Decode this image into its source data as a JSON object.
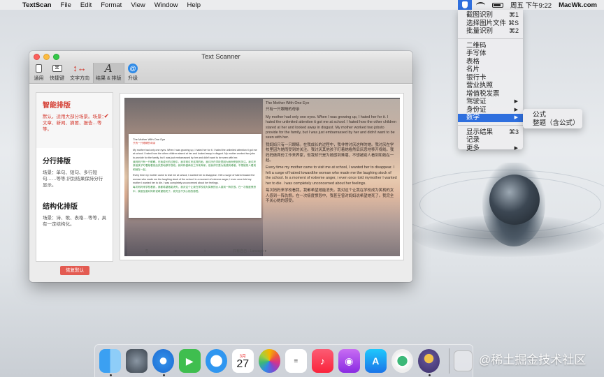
{
  "menubar": {
    "app_name": "TextScan",
    "menus": [
      "File",
      "Edit",
      "Format",
      "View",
      "Window",
      "Help"
    ],
    "clock": "周五 下午9:22",
    "site": "MacWk.com"
  },
  "status_menu": {
    "items": [
      {
        "label": "截图识别",
        "shortcut": "⌘1"
      },
      {
        "label": "选择图片文件",
        "shortcut": "⌘S"
      },
      {
        "label": "批量识别",
        "shortcut": "⌘2"
      }
    ],
    "types": [
      {
        "label": "二维码"
      },
      {
        "label": "手写体"
      },
      {
        "label": "表格"
      },
      {
        "label": "名片"
      },
      {
        "label": "银行卡"
      },
      {
        "label": "营业执照"
      },
      {
        "label": "增值税发票"
      },
      {
        "label": "驾驶证",
        "arrow": "▶"
      },
      {
        "label": "身份证",
        "arrow": "▶"
      },
      {
        "label": "数学",
        "arrow": "▶"
      }
    ],
    "bottom": [
      {
        "label": "显示结果",
        "shortcut": "⌘3"
      },
      {
        "label": "记录"
      },
      {
        "label": "更多",
        "arrow": "▶"
      }
    ],
    "highlighted": "数学"
  },
  "math_submenu": [
    "公式",
    "整题（含公式）"
  ],
  "window": {
    "title": "Text Scanner",
    "toolbar": [
      {
        "label": "通用",
        "icon": "general-icon"
      },
      {
        "label": "快捷键",
        "icon": "shortcut-icon",
        "glyph": "⌘"
      },
      {
        "label": "文字方向",
        "icon": "direction-icon",
        "glyph": "↕↔"
      },
      {
        "label": "结果 & 排版",
        "icon": "result-layout-icon",
        "glyph": "A"
      },
      {
        "label": "升级",
        "icon": "upgrade-icon",
        "glyph": "@"
      }
    ],
    "layout_options": [
      {
        "title": "智能排版",
        "desc": "默认，适用大部分场景。场景：文章、新闻、摘要、报告…等等。",
        "selected": true
      },
      {
        "title": "分行排版",
        "desc": "场景：单句、短句、多行短句……等等,识别结果保持分行显示。",
        "selected": false
      },
      {
        "title": "结构化排版",
        "desc": "场景：诗、歌、表格…等等，具有一定结构化。",
        "selected": false
      }
    ],
    "restore_button": "恢复默认",
    "preview": {
      "card_title": "The Mother With One Eye",
      "card_subtitle": "只有一只眼睛的母亲",
      "card_para1_en": "My mother had only one eyes. When I was growing up, I hated her for it. I hated the unlimited attention it got me at school. I hated how the other children stared at her and looked away in disgust. My mother worked two jobs to provide for the family, but I was just embarrassed by her and didn't want to be seen with her.",
      "card_para1_cn": "我妈妈只有一只眼睛。在我成长的过程中，我非常讨厌这样的她。我讨厌在学校里因为她而受到的关注。我讨厌其他孩子盯着她看然后厌恶地移开视线。我妈妈做两份工作来养家，但我却只是为她感到难堪，不想被别人看到和她在一起。",
      "card_para2_en": "Every time my mother came to visit me at school, I wanted her to disappear. I felt a surge of hatred toward the woman who made me the laughing stock of the school. In a moment of extreme anger, I even once told my mother I wanted her to die. I was completely unconcerned about her feelings.",
      "card_para2_cn": "每次妈妈来学校看我，我都希望她能消失。我对这个让我在学校成为笑柄的女人感到一阵仇恨。在一次极度愤怒中，我甚至曾对妈妈说希望她死了。我完全不关心她的感受。",
      "title": "The Mother With One Eye",
      "subtitle": "只有一只眼睛的母亲",
      "para1_en": "My mother had only one eyes. When I was growing up, I hated her for it. I hated the unlimited attention it got me at school. I hated how the other children stared at her and looked away in disgust. My mother worked two jobsto provide for the family, but I was just embarrassed by her and didn't want to be seen with her.",
      "para1_cn": "我妈妈只有一只眼睛。在我成长的过程中，我非常讨厌这样的她。我讨厌在学校里因为她而受到的关注。我讨厌其他孩子盯着她看然后厌恶地移开视线。我妈妈做两份工作来养家，但我却只是为她感到难堪，不想被别人看到和她在一起。",
      "para2_en": "Every time my mother came to visit me at school, I wanted her to disappear. I felt a surge of hatred towardthe woman who made me the laughing stock of the school. In a moment of extreme anger, i even once told mymother I wanted her to die. I was completely unconcerned about her feelings.",
      "para2_cn": "每次妈妈来学校看我，我都希望她能消失。我对这个让我在学校成为笑柄的女人感到一阵仇恨。在一次极度愤怒中，我甚至曾对妈妈说希望她死了。我完全不关心她的感受。",
      "footer": "只有自己 · Lanuage ▾"
    }
  },
  "dock": {
    "apps": [
      {
        "name": "finder",
        "glyph": ""
      },
      {
        "name": "launchpad",
        "glyph": "🚀"
      },
      {
        "name": "safari",
        "glyph": ""
      },
      {
        "name": "facetime",
        "glyph": "▶"
      },
      {
        "name": "messages",
        "glyph": ""
      },
      {
        "name": "calendar",
        "month": "3月",
        "day": "27"
      },
      {
        "name": "photos",
        "glyph": ""
      },
      {
        "name": "reminders",
        "glyph": "≡"
      },
      {
        "name": "music",
        "glyph": "♪"
      },
      {
        "name": "podcasts",
        "glyph": "◉"
      },
      {
        "name": "app-store",
        "glyph": "A"
      },
      {
        "name": "find-my",
        "glyph": ""
      },
      {
        "name": "text-scanner",
        "glyph": ""
      }
    ]
  },
  "watermark": "@稀土掘金技术社区"
}
